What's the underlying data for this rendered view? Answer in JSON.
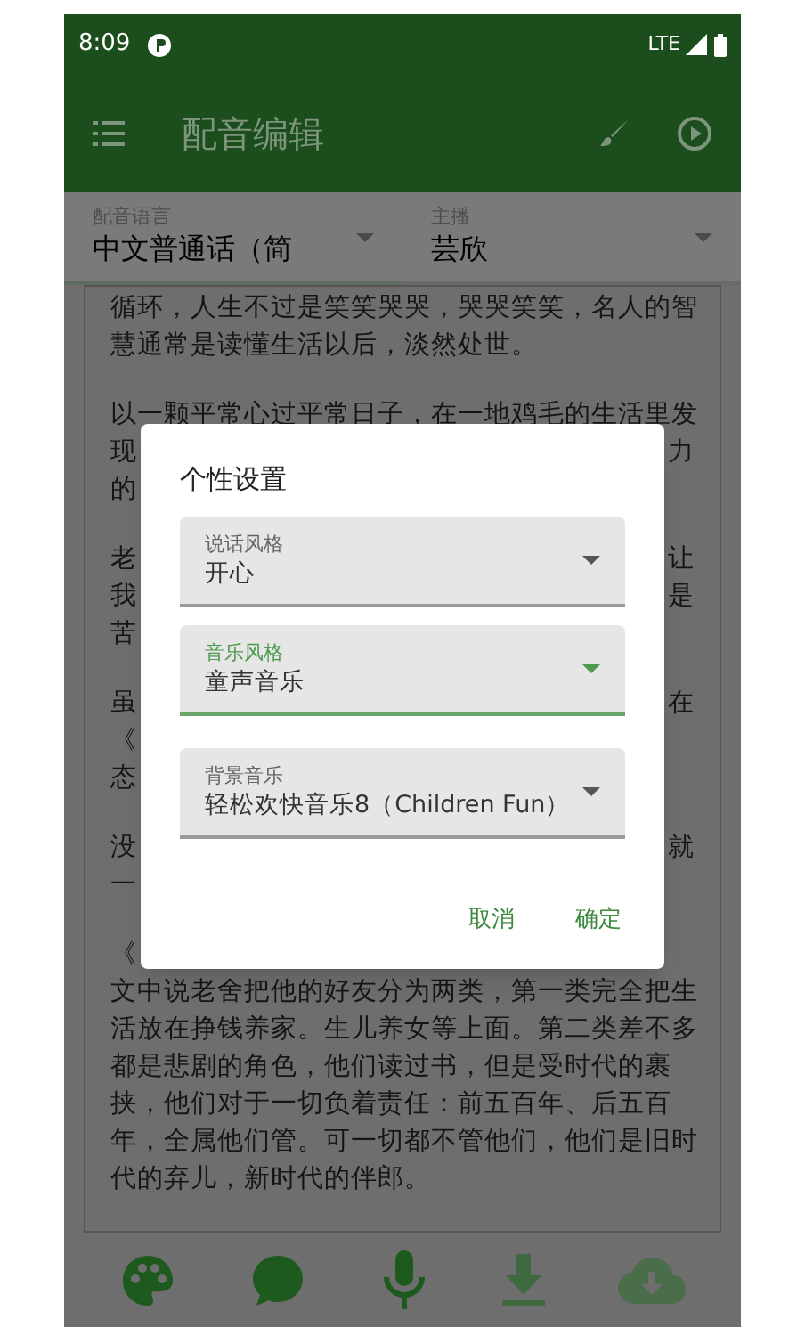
{
  "status_bar": {
    "time": "8:09",
    "network": "LTE"
  },
  "app_bar": {
    "title": "配音编辑"
  },
  "selectors": [
    {
      "label": "配音语言",
      "value": "中文普通话（简"
    },
    {
      "label": "主播",
      "value": "芸欣"
    }
  ],
  "paragraphs": [
    [
      {
        "left": "循环，人生不过是笑笑哭哭，哭哭笑笑，名人的智"
      },
      {
        "left": "慧通常是读懂生活以后，淡然处世。"
      }
    ],
    [
      {
        "left": "以一颗平常心过平常日子，在一地鸡毛的生活里发"
      },
      {
        "left": "现",
        "right": "力"
      },
      {
        "left": "的"
      }
    ],
    [
      {
        "left": "老",
        "right": "让"
      },
      {
        "left": "我",
        "right": "是"
      },
      {
        "left": "苦"
      }
    ],
    [
      {
        "left": "虽",
        "right": "在"
      },
      {
        "left": "《"
      },
      {
        "left": "态"
      }
    ],
    [
      {
        "left": "没",
        "right": "就"
      },
      {
        "left": "一"
      }
    ],
    [
      {
        "left": "《"
      },
      {
        "left": "文中说老舍把他的好友分为两类，第一类完全把生"
      },
      {
        "left": "活放在挣钱养家。生儿养女等上面。第二类差不多"
      },
      {
        "left": "都是悲剧的角色，他们读过书，但是受时代的裹"
      },
      {
        "left": "挟，他们对于一切负着责任：前五百年、后五百"
      },
      {
        "left": "年，全属他们管。可一切都不管他们，他们是旧时"
      },
      {
        "left": "代的弃儿，新时代的伴郎。"
      }
    ]
  ],
  "dialog": {
    "title": "个性设置",
    "fields": [
      {
        "label": "说话风格",
        "value": "开心",
        "focused": false
      },
      {
        "label": "音乐风格",
        "value": "童声音乐",
        "focused": true
      },
      {
        "label": "背景音乐",
        "value": "轻松欢快音乐8（Children Fun）",
        "focused": false
      }
    ],
    "buttons": [
      "取消",
      "确定"
    ]
  }
}
